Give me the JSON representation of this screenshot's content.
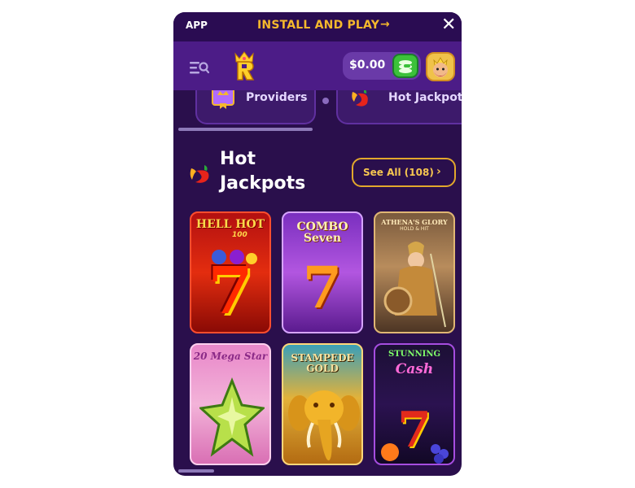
{
  "banner": {
    "app_label": "APP",
    "install_label": "INSTALL AND PLAY",
    "arrow": "→",
    "close": "✕"
  },
  "header": {
    "balance": "$0.00"
  },
  "categories": [
    {
      "label": "Providers",
      "icon": "providers-icon"
    },
    {
      "label": "Hot Jackpots",
      "icon": "chili-icon"
    }
  ],
  "section": {
    "title": "Hot Jackpots",
    "see_all": "See All (108)",
    "chevron": "›"
  },
  "games": [
    {
      "title": "HELL HOT",
      "subtitle": "100"
    },
    {
      "title": "COMBO Seven"
    },
    {
      "title": "ATHENA'S GLORY",
      "subtitle": "HOLD & HIT"
    },
    {
      "title": "20 Mega Star"
    },
    {
      "title": "STAMPEDE GOLD"
    },
    {
      "title": "STUNNING",
      "subtitle": "Cash"
    }
  ],
  "colors": {
    "accent": "#f5b82c",
    "header": "#4c1c87",
    "background": "#2a0f4c"
  }
}
